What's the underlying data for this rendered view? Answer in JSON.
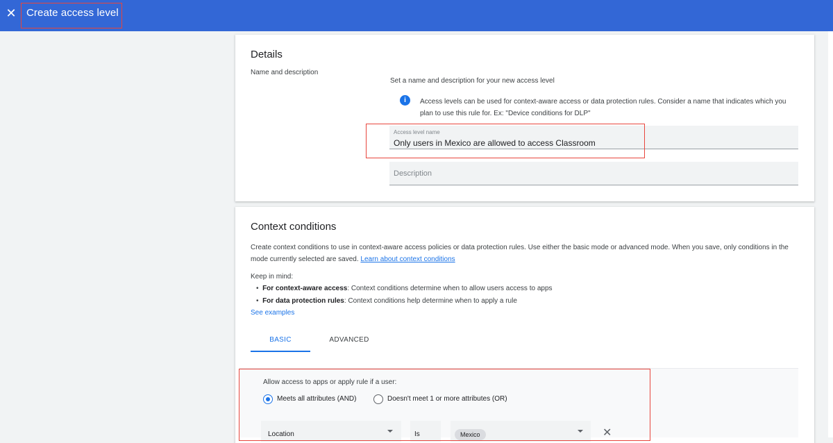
{
  "header": {
    "close_icon_glyph": "✕",
    "title": "Create access level"
  },
  "details": {
    "heading": "Details",
    "subheading": "Name and description",
    "intro": "Set a name and description for your new access level",
    "info_line1": "Access levels can be used for context-aware access or data protection rules. Consider a name that indicates which you",
    "info_line2": "plan to use this rule for. Ex: \"Device conditions for DLP\"",
    "name_field": {
      "label": "Access level name",
      "value": "Only users in Mexico are allowed to access Classroom"
    },
    "description_field": {
      "placeholder": "Description"
    }
  },
  "context": {
    "heading": "Context conditions",
    "desc_line1": "Create context conditions to use in context-aware access policies or data protection rules. Use either the basic mode or advanced mode. When you save, only conditions in the",
    "desc_line2_prefix": "mode currently selected are saved. ",
    "learn_link": "Learn about context conditions",
    "keep_in_mind": "Keep in mind:",
    "bullets": [
      {
        "bold": "For context-aware access",
        "text": ": Context conditions determine when to allow users access to apps"
      },
      {
        "bold": "For data protection rules",
        "text": ": Context conditions help determine when to apply a rule"
      }
    ],
    "see_examples": "See examples",
    "tabs": [
      {
        "label": "BASIC",
        "active": true
      },
      {
        "label": "ADVANCED",
        "active": false
      }
    ],
    "panel": {
      "prompt": "Allow access to apps or apply rule if a user:",
      "options": [
        {
          "label": "Meets all attributes (AND)",
          "checked": true
        },
        {
          "label": "Doesn't meet 1 or more attributes (OR)",
          "checked": false
        }
      ],
      "condition": {
        "attribute": "Location",
        "operator": "Is",
        "value_chip": "Mexico",
        "remove_glyph": "✕"
      }
    }
  },
  "colors": {
    "accent": "#1a73e8",
    "header_bg": "#3367d6",
    "highlight": "#e8453c"
  }
}
